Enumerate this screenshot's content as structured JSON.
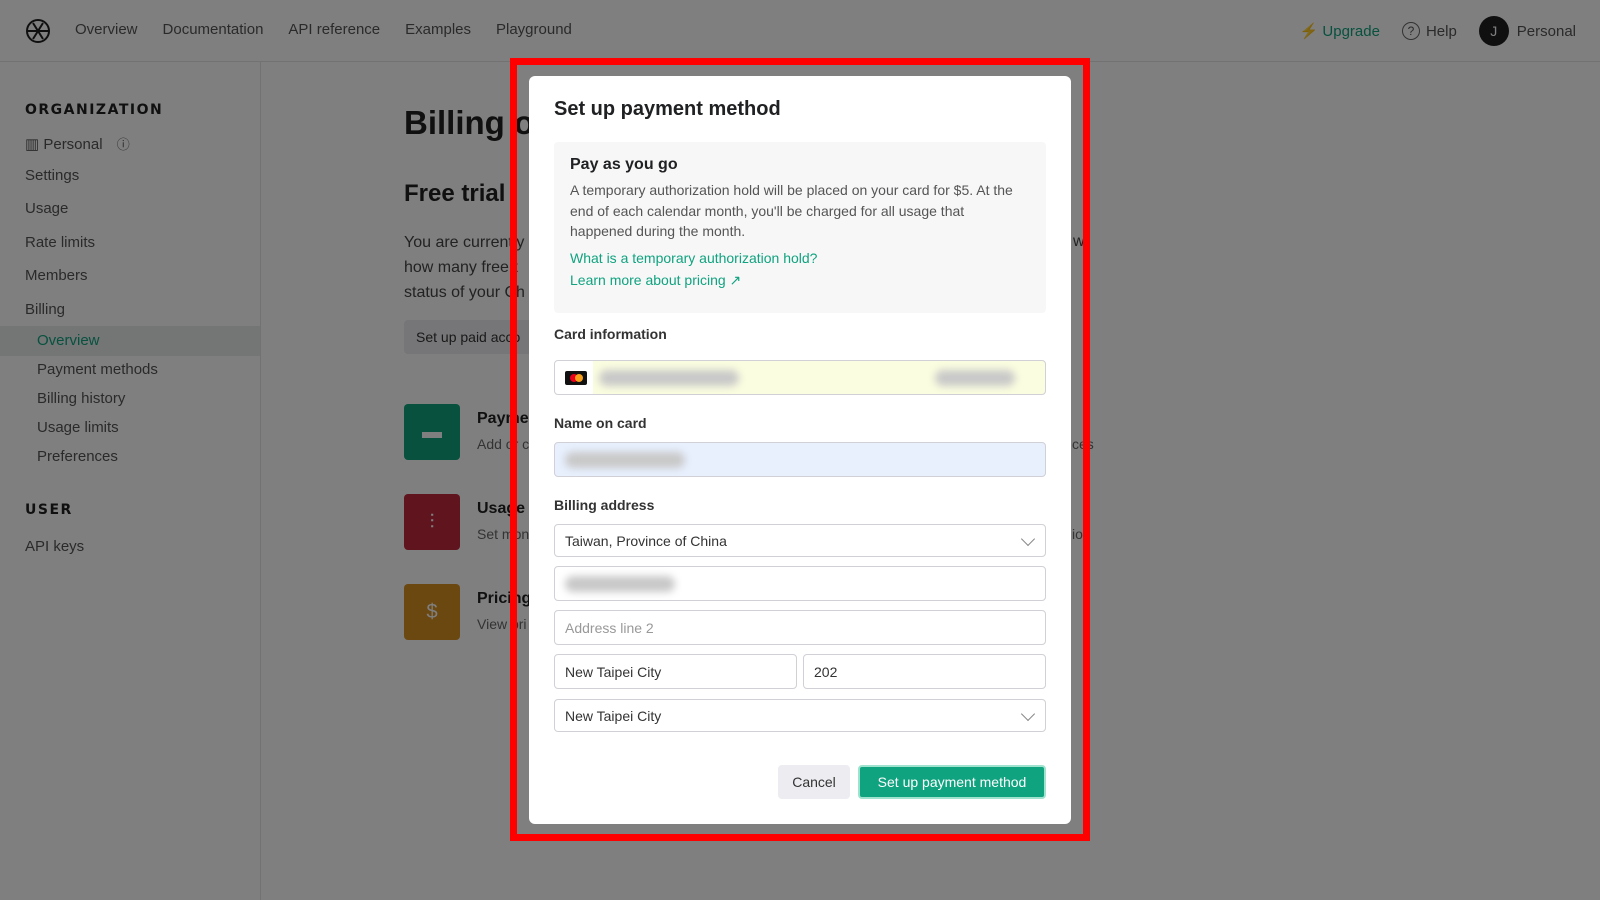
{
  "header": {
    "nav": [
      "Overview",
      "Documentation",
      "API reference",
      "Examples",
      "Playground"
    ],
    "upgrade": "Upgrade",
    "help": "Help",
    "avatar_initial": "J",
    "account": "Personal"
  },
  "sidebar": {
    "org_heading": "ORGANIZATION",
    "org_name": "Personal",
    "items": [
      "Settings",
      "Usage",
      "Rate limits",
      "Members",
      "Billing"
    ],
    "billing_sub": [
      "Overview",
      "Payment methods",
      "Billing history",
      "Usage limits",
      "Preferences"
    ],
    "user_heading": "USER",
    "user_items": [
      "API keys"
    ]
  },
  "page": {
    "title": "Billing o",
    "subtitle": "Free trial",
    "para_lines": [
      "You are currently",
      "how many free t",
      "status of your Ch"
    ],
    "paid_button": "Set up paid acco",
    "cards": [
      {
        "title": "Payme",
        "desc": "Add or c",
        "tail": "ces"
      },
      {
        "title": "Usage",
        "desc": "Set mon",
        "tail": "ion"
      },
      {
        "title": "Pricing",
        "desc": "View pri",
        "tail": ""
      }
    ],
    "para_tail": "w"
  },
  "modal": {
    "title": "Set up payment method",
    "info_title": "Pay as you go",
    "info_text": "A temporary authorization hold will be placed on your card for $5. At the end of each calendar month, you'll be charged for all usage that happened during the month.",
    "link_hold": "What is a temporary authorization hold?",
    "link_pricing": "Learn more about pricing",
    "card_label": "Card information",
    "name_label": "Name on card",
    "billing_label": "Billing address",
    "country": "Taiwan, Province of China",
    "address2_placeholder": "Address line 2",
    "city": "New Taipei City",
    "postal": "202",
    "state": "New Taipei City",
    "cancel": "Cancel",
    "submit": "Set up payment method"
  },
  "colors": {
    "accent": "#10a37f",
    "highlight": "#ff0000"
  }
}
